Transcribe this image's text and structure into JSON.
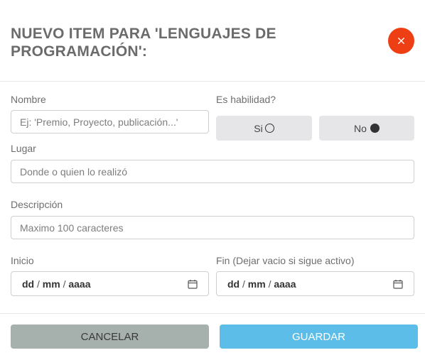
{
  "modal": {
    "title": "NUEVO ITEM PARA 'LENGUAJES DE PROGRAMACIÓN':"
  },
  "form": {
    "nombre": {
      "label": "Nombre",
      "placeholder": "Ej: 'Premio, Proyecto, publicación...'",
      "value": ""
    },
    "habilidad": {
      "label": "Es habilidad?",
      "options": [
        {
          "label": "Si",
          "selected": false,
          "icon": "radio-empty-icon"
        },
        {
          "label": "No",
          "selected": true,
          "icon": "radio-filled-icon"
        }
      ]
    },
    "lugar": {
      "label": "Lugar",
      "placeholder": "Donde o quien lo realizó",
      "value": ""
    },
    "descripcion": {
      "label": "Descripción",
      "placeholder": "Maximo 100 caracteres",
      "value": ""
    },
    "inicio": {
      "label": "Inicio",
      "dd": "dd",
      "mm": "mm",
      "yyyy": "aaaa",
      "sep": "/",
      "icon": "calendar-icon"
    },
    "fin": {
      "label": "Fin (Dejar vacio si sigue activo)",
      "dd": "dd",
      "mm": "mm",
      "yyyy": "aaaa",
      "sep": "/",
      "icon": "calendar-icon"
    }
  },
  "footer": {
    "cancel_label": "CANCELAR",
    "save_label": "GUARDAR"
  },
  "colors": {
    "close_button": "#ee3f14",
    "cancel_button": "#a6b0ac",
    "save_button": "#5bbde8"
  }
}
